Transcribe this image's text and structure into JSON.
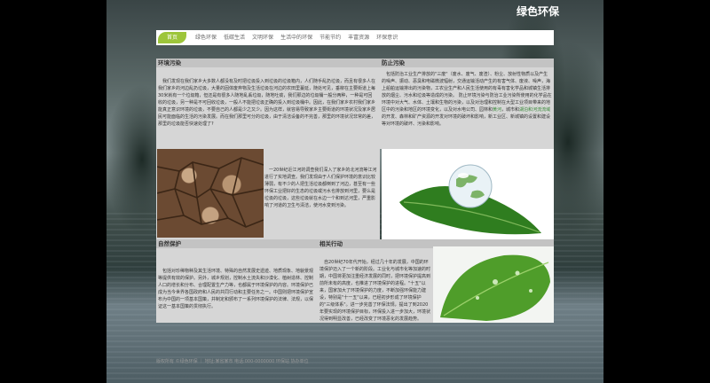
{
  "brand": "绿色环保",
  "nav": [
    "首页",
    "绿色环保",
    "低碳生活",
    "文明环保",
    "生活中的环保",
    "节能节约",
    "丰富资源",
    "环保意识"
  ],
  "sections": {
    "env_pollution": {
      "title": "环境污染",
      "para1": "我们发现在我们家乡大多数人都没有及时把垃圾投入到垃圾的垃圾箱内，人们随手乱扔垃圾，而且有很多人在我们家乡的河边乱扔垃圾，大量的固体废弃物及生活垃圾在河边的农田里蔓延，随处可见，垂柳在主要街道上每30米就有一个垃圾箱，但还是有很多人随地乱丢垃圾，随地吐痰，我们那边的垃圾桶一般分两种，一种是可回收的垃圾，另一种是不可回收垃圾，一般人不能把垃圾正确的投入到垃圾桶中。因此，在我们家乡农村我们家乡能真正意识环境的垃圾，不要自己的人都是少之又少。因为这样，就容易导致家乡主要街道的环境状况及家乡居民可能面临的生活的污染发展。而在我们那里可分的垃圾，由于清洁设备的不完善，那里的环境状况非常的差，那里的垃圾能否快速处理了?",
      "para2": "一20世纪近江河的调查我们深入了家乡的北河流等江河进行了实地调查。我们发现由于人们保护环境的意识比较薄弱，有不少的人把生活垃圾都倒到了河边，甚至有一些环保工业把好的生态的垃圾或污水也排放到河里，要么是垃圾的垃圾，这些垃圾就在水边一个和到达河里，严重影响了河道的卫生与清洁，使河水变到污染。"
    },
    "prevent_pollution": {
      "title": "防止污染",
      "para1": "包括防治工业生产排放的\"三废\"（废水、废气、废渣）、粉尘、放射性物质以及产生的噪声、振动、恶臭和电磁微波辐射，交通运输活动产生的有害气体、废液、噪声，海上船舶运输排出的污染物，工农业生产和人民生活使用的有毒有害化学品和城镇生活排放的烟尘、污水和垃圾等造成的污染。",
      "para2_before": "防止环境污染与防治工业污染所使用的化学品在环境中对大气、水体、土壤和生物的污染，以及对治理和控制在大型工业项目带来的地区中的污染和地区的环境变化，以及对水电公司、园林和",
      "para2_link1": "黄河",
      "para2_mid": "，城市和",
      "para2_link2": "湖泊和",
      "para2_link3": "河流流域",
      "para2_after": "的开发、森林和矿产资源的开发对环境的破坏和影响，新工业区、新城镇的设置和建设等对环境的破坏、污染和影响。"
    },
    "nature_protect": {
      "title": "自然保护",
      "para": "包括对珍稀物种及其生活环境、特殊的自然发展史遗迹、地质现象、地貌景观等提供有效的保护。另外，城乡规划，控制水土流失和沙漠化、植树造林、控制人口的增长和分布、合理配置生产力等，也都属于环境保护的内容。环境保护已成为当今世界各国政府和人民的共同行动和主要任务之一。中国则把环境保护宣布为中国的一项基本国策，并制定和颁布了一系列环境保护的法律、法规，以保证这一基本国策的贯彻执行。"
    },
    "policy": {
      "title": "相关行动",
      "para": "自20世纪70年代开始，经过几十年的发展，中国的环境保护迈入了一个新的阶段。工业化与城市化等加速的时期，中国将更加注重经济发展的同时，把环境保护提高到前所未有的高度，也推进了环境保护的进程。\"十五\"以来，国家加大了环境保护的力度，不断加强环保能力建设，特别是\"十一五\"以来，已经初步形成了环境保护的\"三级体系\"。进一步完善了环保法规，提出了到2020年要实现的环境保护目标，环保投入进一步加大，环境状况得到明显改善，已经改变了环境恶化的发展趋势。"
    }
  },
  "footer": "版权所有 ©绿色环保 ｜ 地址:某省某市 电话:000-0000000 环保站 协办单位"
}
